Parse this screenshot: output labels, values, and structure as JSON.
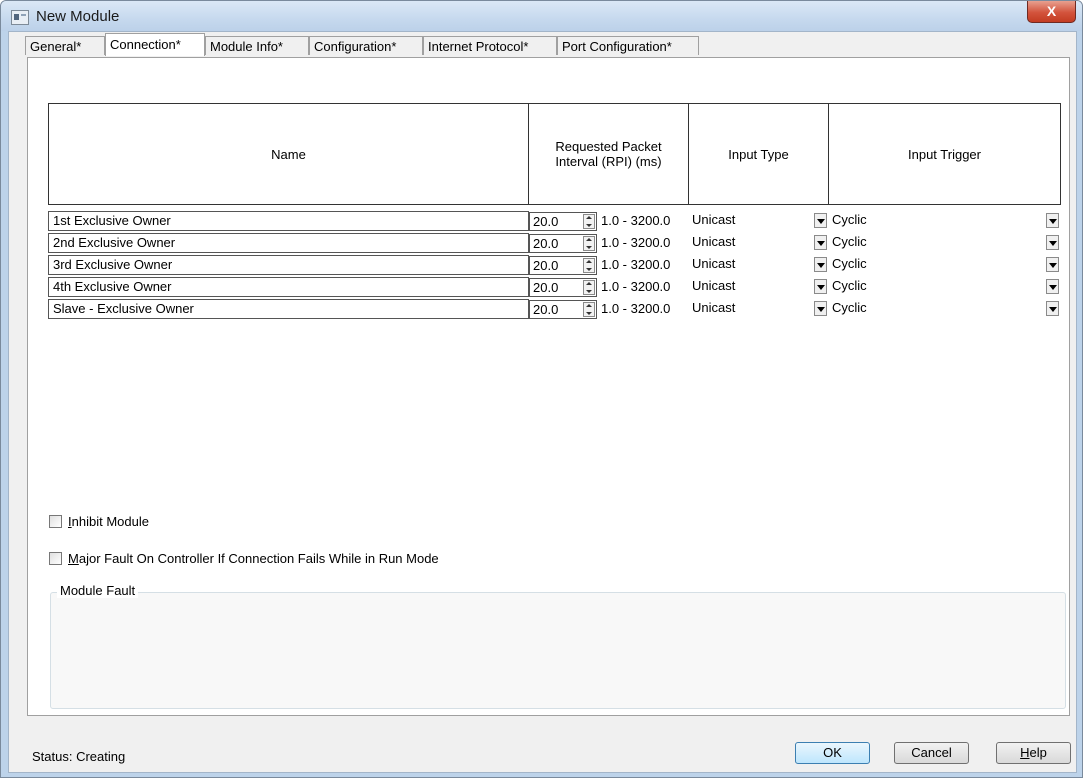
{
  "window": {
    "title": "New Module",
    "close_glyph": "X"
  },
  "tabs": [
    {
      "label": "General*"
    },
    {
      "label": "Connection*"
    },
    {
      "label": "Module Info*"
    },
    {
      "label": "Configuration*"
    },
    {
      "label": "Internet Protocol*"
    },
    {
      "label": "Port Configuration*"
    }
  ],
  "active_tab": "Connection*",
  "table": {
    "headers": {
      "name": "Name",
      "rpi": "Requested Packet Interval (RPI) (ms)",
      "input_type": "Input Type",
      "input_trigger": "Input Trigger"
    },
    "rows": [
      {
        "name": "1st Exclusive Owner",
        "rpi": "20.0",
        "range": "1.0 - 3200.0",
        "input_type": "Unicast",
        "input_trigger": "Cyclic"
      },
      {
        "name": "2nd Exclusive Owner",
        "rpi": "20.0",
        "range": "1.0 - 3200.0",
        "input_type": "Unicast",
        "input_trigger": "Cyclic"
      },
      {
        "name": "3rd Exclusive Owner",
        "rpi": "20.0",
        "range": "1.0 - 3200.0",
        "input_type": "Unicast",
        "input_trigger": "Cyclic"
      },
      {
        "name": "4th Exclusive Owner",
        "rpi": "20.0",
        "range": "1.0 - 3200.0",
        "input_type": "Unicast",
        "input_trigger": "Cyclic"
      },
      {
        "name": "Slave - Exclusive Owner",
        "rpi": "20.0",
        "range": "1.0 - 3200.0",
        "input_type": "Unicast",
        "input_trigger": "Cyclic"
      }
    ]
  },
  "checkboxes": {
    "inhibit_first": "I",
    "inhibit_rest": "nhibit Module",
    "major_first": "M",
    "major_rest": "ajor Fault On Controller If Connection Fails While in Run Mode"
  },
  "module_fault": {
    "label": "Module Fault"
  },
  "status": {
    "text": "Status:  Creating"
  },
  "buttons": {
    "ok": "OK",
    "cancel": "Cancel",
    "help_first": "H",
    "help_rest": "elp"
  }
}
